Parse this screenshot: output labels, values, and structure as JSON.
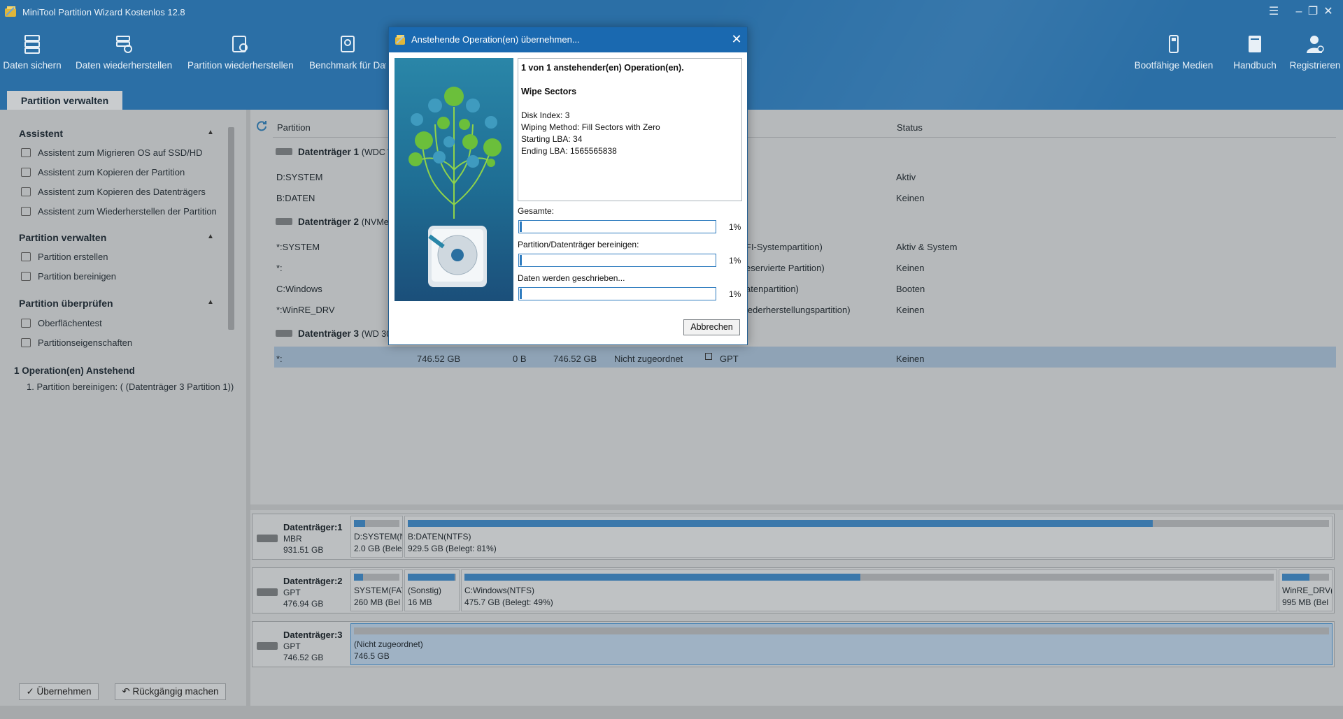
{
  "app": {
    "title": "MiniTool Partition Wizard Kostenlos 12.8",
    "window_controls": [
      "menu",
      "minimize",
      "restore",
      "close"
    ]
  },
  "toolbar": {
    "left_items": [
      {
        "label": "Daten sichern",
        "icon": "backup-icon"
      },
      {
        "label": "Daten wiederherstellen",
        "icon": "data-recovery-icon"
      },
      {
        "label": "Partition wiederherstellen",
        "icon": "partition-recovery-icon"
      },
      {
        "label": "Benchmark für Date",
        "icon": "benchmark-icon"
      }
    ],
    "right_items": [
      {
        "label": "Bootfähige Medien",
        "icon": "bootable-media-icon"
      },
      {
        "label": "Handbuch",
        "icon": "manual-icon"
      },
      {
        "label": "Registrieren",
        "icon": "register-icon"
      }
    ]
  },
  "tab": {
    "label": "Partition verwalten"
  },
  "sidebar": {
    "sections": [
      {
        "title": "Assistent",
        "items": [
          "Assistent zum Migrieren OS auf SSD/HD",
          "Assistent zum Kopieren der Partition",
          "Assistent zum Kopieren des Datenträgers",
          "Assistent zum Wiederherstellen der Partition"
        ]
      },
      {
        "title": "Partition verwalten",
        "items": [
          "Partition erstellen",
          "Partition bereinigen"
        ]
      },
      {
        "title": "Partition überprüfen",
        "items": [
          "Oberflächentest",
          "Partitionseigenschaften"
        ]
      }
    ],
    "pending_title": "1 Operation(en) Anstehend",
    "pending_items": [
      "1. Partition bereinigen: ( (Datenträger 3 Partition 1))"
    ],
    "apply_button": "Übernehmen",
    "undo_button": "Rückgängig machen"
  },
  "table": {
    "headers": {
      "partition": "Partition",
      "status": "Status"
    },
    "disks": [
      {
        "label": "Datenträger 1",
        "suffix": "(WDC W"
      },
      {
        "label": "Datenträger 2",
        "suffix": "(NVMe"
      },
      {
        "label": "Datenträger 3",
        "suffix": "(WD 30"
      }
    ],
    "rows": [
      {
        "name": "D:SYSTEM",
        "typeinfo": "",
        "status": "Aktiv"
      },
      {
        "name": "B:DATEN",
        "typeinfo": "",
        "status": "Keinen"
      },
      {
        "name": "*:SYSTEM",
        "typeinfo": "FI-Systempartition)",
        "status": "Aktiv & System"
      },
      {
        "name": "*:",
        "typeinfo": "eservierte Partition)",
        "status": "Keinen"
      },
      {
        "name": "C:Windows",
        "typeinfo": "atenpartition)",
        "status": "Booten"
      },
      {
        "name": "*:WinRE_DRV",
        "typeinfo": "iederherstellungspartition)",
        "status": "Keinen"
      }
    ],
    "selected_row": {
      "name": "*:",
      "capacity": "746.52 GB",
      "used": "0 B",
      "unused": "746.52 GB",
      "filesystem": "Nicht zugeordnet",
      "type": "GPT",
      "status": "Keinen"
    }
  },
  "diskmap": [
    {
      "name": "Datenträger:1",
      "type": "MBR",
      "size": "931.51 GB",
      "segments": [
        {
          "label": "D:SYSTEM(N",
          "detail": "2.0 GB (Bele",
          "used_fraction": 0.25
        },
        {
          "label": "B:DATEN(NTFS)",
          "detail": "929.5 GB (Belegt: 81%)",
          "used_fraction": 0.81
        }
      ]
    },
    {
      "name": "Datenträger:2",
      "type": "GPT",
      "size": "476.94 GB",
      "segments": [
        {
          "label": "SYSTEM(FAT",
          "detail": "260 MB (Bel",
          "used_fraction": 0.2
        },
        {
          "label": "(Sonstig)",
          "detail": "16 MB",
          "used_fraction": 1.0
        },
        {
          "label": "C:Windows(NTFS)",
          "detail": "475.7 GB (Belegt: 49%)",
          "used_fraction": 0.49
        },
        {
          "label": "WinRE_DRV(",
          "detail": "995 MB (Bel",
          "used_fraction": 0.6
        }
      ]
    },
    {
      "name": "Datenträger:3",
      "type": "GPT",
      "size": "746.52 GB",
      "segments": [
        {
          "label": "(Nicht zugeordnet)",
          "detail": "746.5 GB",
          "used_fraction": 0.0
        }
      ]
    }
  ],
  "dialog": {
    "title": "Anstehende Operation(en) übernehmen...",
    "summary": "1 von 1 anstehender(en) Operation(en).",
    "operation": "Wipe Sectors",
    "details": [
      "Disk Index: 3",
      "Wiping Method: Fill Sectors with Zero",
      "Starting LBA: 34",
      "Ending LBA: 1565565838"
    ],
    "progress": [
      {
        "label": "Gesamte:",
        "percent_text": "1%",
        "value": 0.01
      },
      {
        "label": "Partition/Datenträger bereinigen:",
        "percent_text": "1%",
        "value": 0.01
      },
      {
        "label": "Daten werden geschrieben...",
        "percent_text": "1%",
        "value": 0.01
      }
    ],
    "cancel_button": "Abbrechen"
  },
  "colors": {
    "dialog_titlebar": "#1a69b0",
    "progress_border": "#2f7cbf",
    "usage_bar": "#3b78ab",
    "selected_row": "#8fa3b6"
  }
}
